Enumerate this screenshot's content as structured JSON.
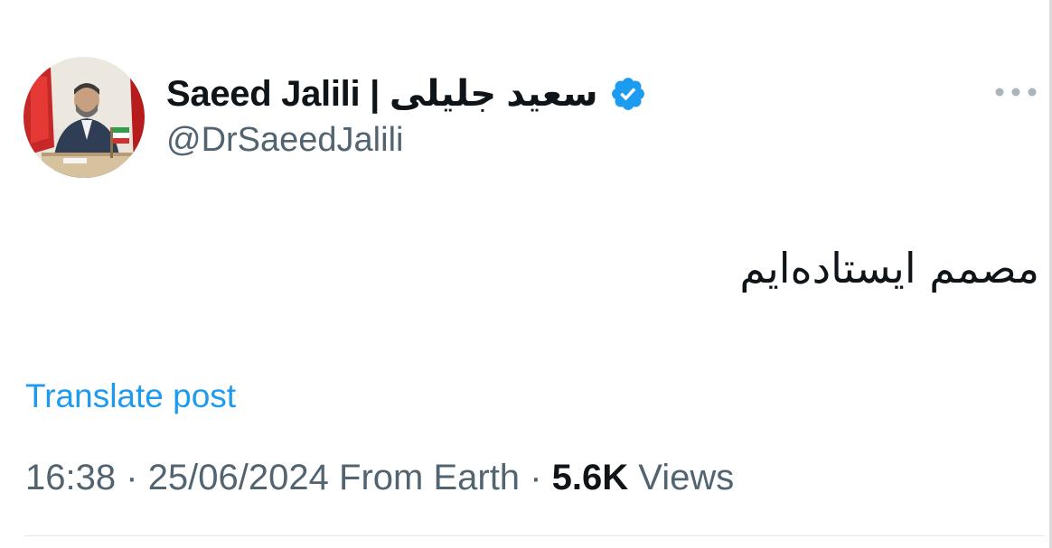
{
  "author": {
    "display_name": "Saeed Jalili | سعید جلیلی",
    "handle": "@DrSaeedJalili",
    "verified": true,
    "avatar_icon": "profile-photo"
  },
  "tweet": {
    "text": "مصمم ایستاده‌ایم",
    "translate_label": "Translate post"
  },
  "meta": {
    "time": "16:38",
    "separator": "·",
    "date": "25/06/2024",
    "source": "From Earth",
    "views_count": "5.6K",
    "views_label": "Views"
  },
  "colors": {
    "accent": "#1d9bf0",
    "secondary_text": "#536471",
    "primary_text": "#0f1419"
  },
  "icons": {
    "verified": "verified-badge-icon",
    "more": "more-options-icon"
  }
}
